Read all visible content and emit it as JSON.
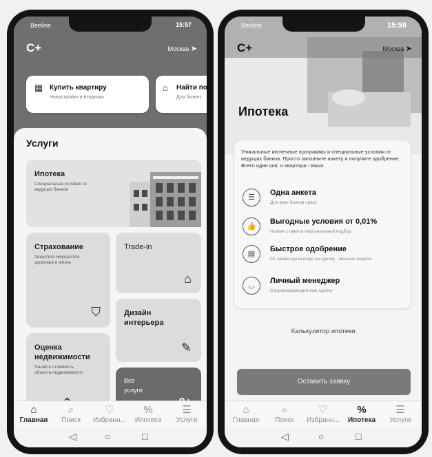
{
  "left_phone": {
    "status": {
      "carrier": "Beeline",
      "time": "15:57"
    },
    "logo": "C+",
    "city": "Москва",
    "quick_cards": [
      {
        "title": "Купить квартиру",
        "subtitle": "Новостройки и вторичка"
      },
      {
        "title": "Найти по",
        "subtitle": "Для бизнес"
      }
    ],
    "services_title": "Услуги",
    "services": [
      {
        "title": "Ипотека",
        "subtitle": "Специальные условия от ведущих банков"
      },
      {
        "title": "Страхование",
        "subtitle": "Защитите имущество, здоровье и жизнь"
      },
      {
        "title": "Trade-in",
        "subtitle": ""
      },
      {
        "title": "Дизайн интерьера",
        "subtitle": ""
      },
      {
        "title": "Оценка недвижимости",
        "subtitle": "Узнайте стоимость объекта недвижимости"
      },
      {
        "title": "Все услуги",
        "subtitle": "9+"
      }
    ],
    "nav": [
      {
        "label": "Главная",
        "icon": "home-icon",
        "active": true
      },
      {
        "label": "Поиск",
        "icon": "search-icon",
        "active": false
      },
      {
        "label": "Избранн...",
        "icon": "heart-icon",
        "active": false
      },
      {
        "label": "Ипотека",
        "icon": "percent-icon",
        "active": false
      },
      {
        "label": "Услуги",
        "icon": "services-icon",
        "active": false
      }
    ]
  },
  "right_phone": {
    "status": {
      "carrier": "Beeline",
      "time": "15:58"
    },
    "logo": "C+",
    "city": "Москва",
    "title": "Ипотека",
    "intro": "Уникальные ипотечные программы и специальные условия от ведущих банков. Просто заполните анкету и получите одобрение. Всего один шаг, и квартира - ваша.",
    "features": [
      {
        "title": "Одна анкета",
        "subtitle": "Для всех банков сразу",
        "icon": "document-icon"
      },
      {
        "title": "Выгодные условия от 0,01%",
        "subtitle": "Низкие ставки и персональный подбор",
        "icon": "thumbs-up-icon"
      },
      {
        "title": "Быстрое одобрение",
        "subtitle": "От заявки до выхода на сделку - меньше недели",
        "icon": "calendar-icon"
      },
      {
        "title": "Личный менеджер",
        "subtitle": "Сопровождающий всю сделку",
        "icon": "chat-icon"
      }
    ],
    "calculator_label": "Калькулятор ипотеки",
    "submit_label": "Оставить заявку",
    "nav": [
      {
        "label": "Главная",
        "icon": "home-icon",
        "active": false
      },
      {
        "label": "Поиск",
        "icon": "search-icon",
        "active": false
      },
      {
        "label": "Избранн...",
        "icon": "heart-icon",
        "active": false
      },
      {
        "label": "Ипотека",
        "icon": "percent-icon",
        "active": true
      },
      {
        "label": "Услуги",
        "icon": "services-icon",
        "active": false
      }
    ]
  }
}
